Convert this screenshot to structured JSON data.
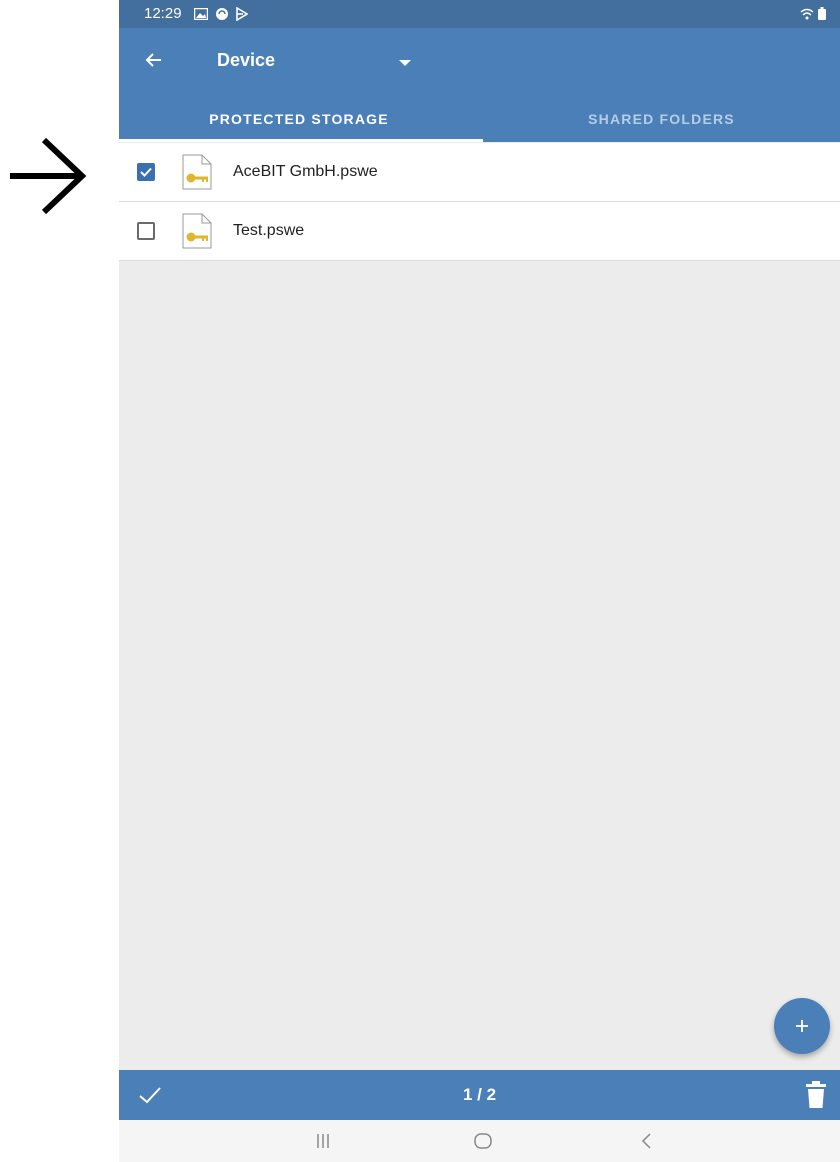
{
  "status_bar": {
    "time": "12:29",
    "icons": [
      "gallery-icon",
      "sync-icon",
      "play-icon"
    ],
    "right_icons": [
      "wifi-icon",
      "battery-icon"
    ]
  },
  "app_bar": {
    "back_icon": "arrow-left-icon",
    "title": "Device",
    "title_dropdown_icon": "caret-down-icon"
  },
  "tabs": [
    {
      "label": "PROTECTED STORAGE",
      "selected": true
    },
    {
      "label": "SHARED FOLDERS",
      "selected": false
    }
  ],
  "files": [
    {
      "name": "AceBIT GmbH.pswe",
      "checked": true,
      "icon": "key-file-icon"
    },
    {
      "name": "Test.pswe",
      "checked": false,
      "icon": "key-file-icon"
    }
  ],
  "fab": {
    "icon": "plus-icon"
  },
  "bottom_bar": {
    "confirm_icon": "check-icon",
    "counter": "1 / 2",
    "delete_icon": "trash-icon"
  },
  "nav_bar": {
    "icons": [
      "recents-icon",
      "home-icon",
      "back-icon"
    ]
  },
  "colors": {
    "app_bar": "#4a7fb8",
    "status_bar": "#436f9f",
    "background": "#ececec",
    "checkbox_checked": "#3a6fb0",
    "key_icon": "#e0b530"
  }
}
